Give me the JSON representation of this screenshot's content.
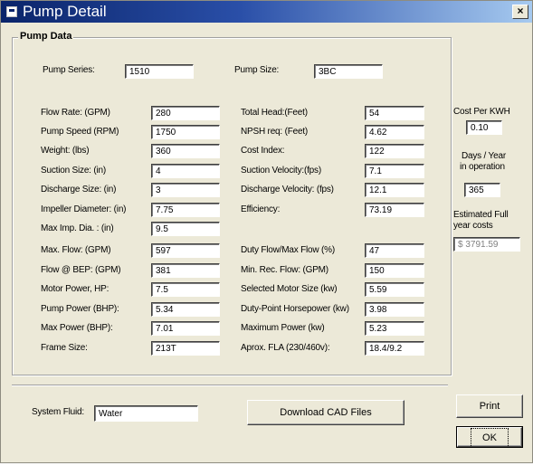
{
  "window": {
    "title": "Pump Detail",
    "close_glyph": "×"
  },
  "group": {
    "title": "Pump Data"
  },
  "top": {
    "series_label": "Pump Series:",
    "series_value": "1510",
    "size_label": "Pump Size:",
    "size_value": "3BC"
  },
  "left_fields": [
    {
      "label": "Flow Rate: (GPM)",
      "value": "280"
    },
    {
      "label": "Pump Speed (RPM)",
      "value": "1750"
    },
    {
      "label": "Weight: (lbs)",
      "value": "360"
    },
    {
      "label": "Suction Size: (in)",
      "value": "4"
    },
    {
      "label": "Discharge Size: (in)",
      "value": "3"
    },
    {
      "label": "Impeller Diameter: (in)",
      "value": "7.75"
    },
    {
      "label": "Max Imp. Dia. : (in)",
      "value": "9.5"
    },
    {
      "label": "Max. Flow: (GPM)",
      "value": "597"
    },
    {
      "label": "Flow @ BEP: (GPM)",
      "value": "381"
    },
    {
      "label": "Motor Power, HP:",
      "value": "7.5"
    },
    {
      "label": "Pump Power (BHP):",
      "value": "5.34"
    },
    {
      "label": "Max Power (BHP):",
      "value": "7.01"
    },
    {
      "label": "Frame Size:",
      "value": "213T"
    }
  ],
  "right_fields": [
    {
      "label": "Total Head:(Feet)",
      "value": "54"
    },
    {
      "label": "NPSH req: (Feet)",
      "value": "4.62"
    },
    {
      "label": "Cost Index:",
      "value": "122"
    },
    {
      "label": "Suction Velocity:(fps)",
      "value": "7.1"
    },
    {
      "label": "Discharge Velocity: (fps)",
      "value": "12.1"
    },
    {
      "label": "Efficiency:",
      "value": "73.19"
    },
    {
      "label": "Duty Flow/Max Flow (%)",
      "value": "47"
    },
    {
      "label": "Min. Rec. Flow: (GPM)",
      "value": "150"
    },
    {
      "label": "Selected Motor Size (kw)",
      "value": "5.59"
    },
    {
      "label": "Duty-Point Horsepower (kw)",
      "value": "3.98"
    },
    {
      "label": "Maximum Power (kw)",
      "value": "5.23"
    },
    {
      "label": "Aprox. FLA (230/460v):",
      "value": "18.4/9.2"
    }
  ],
  "side": {
    "cost_label": "Cost Per KWH",
    "cost_value": "0.10",
    "days_label_1": "Days / Year",
    "days_label_2": "in operation",
    "days_value": "365",
    "est_label_1": "Estimated Full",
    "est_label_2": "year costs",
    "est_value": "$ 3791.59"
  },
  "bottom": {
    "fluid_label": "System Fluid:",
    "fluid_value": "Water",
    "download_label": "Download CAD Files",
    "print_label": "Print",
    "ok_label": "OK"
  }
}
